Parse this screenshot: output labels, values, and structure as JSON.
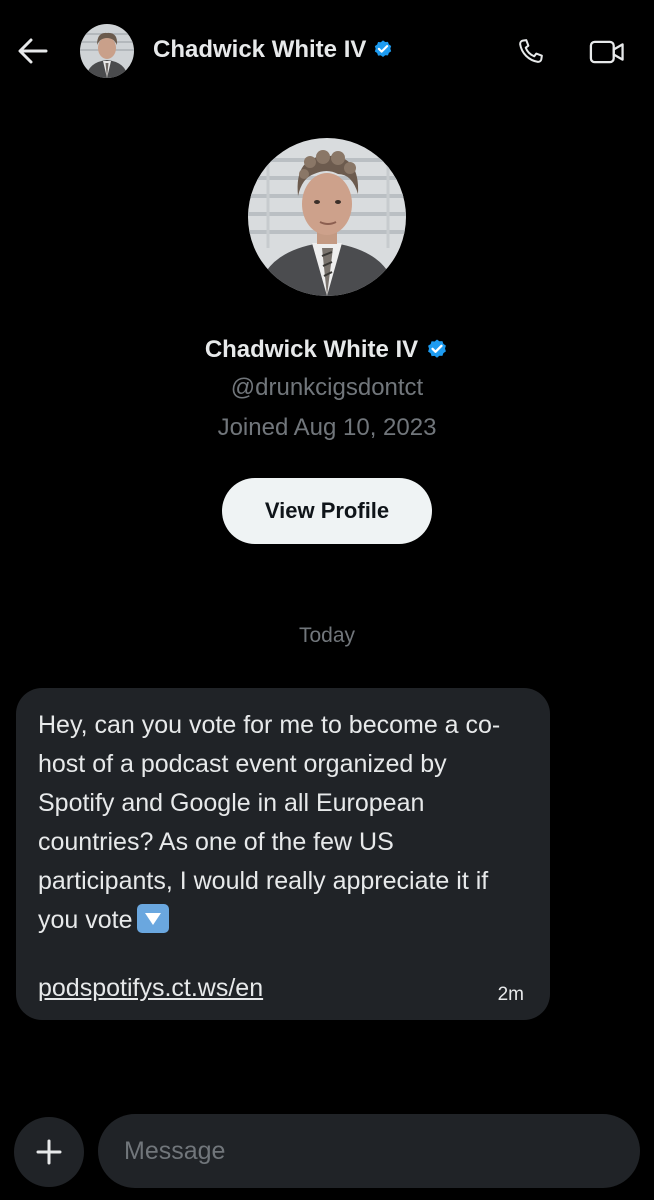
{
  "header": {
    "back_icon": "arrow-left-icon",
    "name": "Chadwick White IV",
    "verified_icon": "verified-badge-icon",
    "phone_icon": "phone-icon",
    "video_icon": "video-camera-icon"
  },
  "profile": {
    "name": "Chadwick White IV",
    "handle": "@drunkcigsdontct",
    "joined": "Joined Aug 10, 2023",
    "view_profile_label": "View Profile"
  },
  "conversation": {
    "date_separator": "Today",
    "messages": [
      {
        "text": "Hey, can you vote for me to become a co-host of a podcast event organized by Spotify and Google in all European countries? As one of the few US participants, I would really appreciate it if you vote",
        "emoji": "down-arrow-emoji",
        "link": "podspotifys.ct.ws/en",
        "time": "2m"
      }
    ]
  },
  "composer": {
    "plus_icon": "plus-icon",
    "placeholder": "Message"
  },
  "colors": {
    "background": "#000000",
    "bubble": "#202327",
    "verified": "#1d9bf0",
    "muted_text": "#71767b",
    "text": "#e7e9ea",
    "button_bg": "#eff3f4"
  }
}
